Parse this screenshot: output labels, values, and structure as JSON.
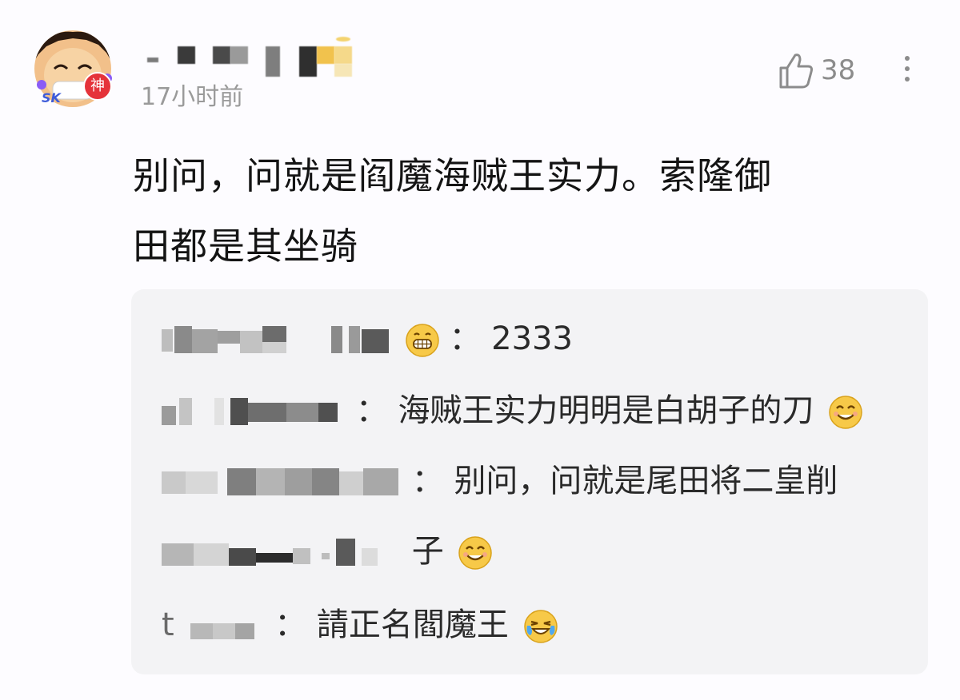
{
  "comment": {
    "avatar_badge": "神",
    "avatar_tag": "SK",
    "time": "17小时前",
    "likes": "38",
    "text_line1": "别问，问就是阎魔海贼王实力。索隆御",
    "text_line2": "田都是其坐骑"
  },
  "replies": [
    {
      "sep": "：",
      "text": "2333",
      "emoji": "grin-emoji"
    },
    {
      "sep": "：",
      "text": "海贼王实力明明是白胡子的刀",
      "emoji": "smile-emoji"
    },
    {
      "sep": "：",
      "text": "别问，问就是尾田将二皇削",
      "continuation": "子",
      "emoji": "smile-emoji"
    },
    {
      "sep": "：",
      "name_hint": "t",
      "text": "請正名閻魔王",
      "emoji": "laugh-cry-emoji"
    }
  ],
  "colors": {
    "background": "#fdfcff",
    "reply_bg": "#f3f3f5",
    "muted": "#9a9a9a",
    "badge": "#e5333a"
  }
}
